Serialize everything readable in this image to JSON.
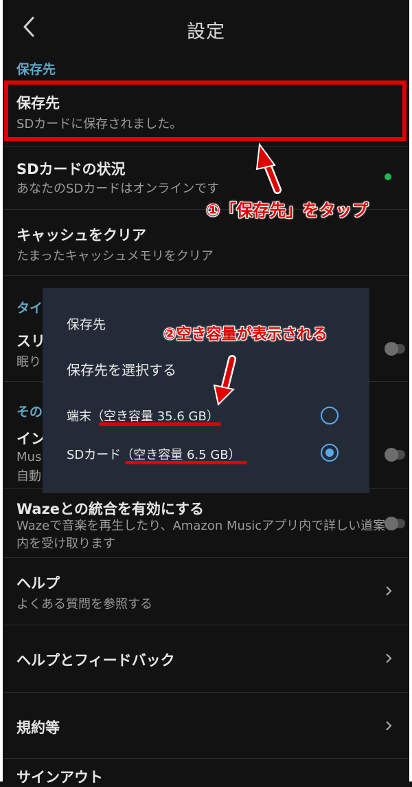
{
  "header": {
    "title": "設定",
    "back_icon": "chevron-left-icon"
  },
  "sections": {
    "storage_label": "保存先",
    "timer_label": "タイ",
    "other_label": "その"
  },
  "rows": {
    "storage": {
      "title": "保存先",
      "subtitle": "SDカードに保存されました。"
    },
    "sd_status": {
      "title": "SDカードの状況",
      "subtitle": "あなたのSDカードはオンラインです"
    },
    "clear_cache": {
      "title": "キャッシュをクリア",
      "subtitle": "たまったキャッシュメモリをクリア"
    },
    "sleep": {
      "title": "スリ",
      "subtitle": "眠り"
    },
    "install": {
      "title": "イン",
      "subtitle1": "Mus",
      "subtitle2": "自動"
    },
    "waze": {
      "title": "Wazeとの統合を有効にする",
      "subtitle": "Wazeで音楽を再生したり、Amazon Musicアプリ内で詳しい道案内を受け取ります"
    },
    "help": {
      "title": "ヘルプ",
      "subtitle": "よくある質問を参照する"
    },
    "help_feedback": {
      "title": "ヘルプとフィードバック"
    },
    "terms": {
      "title": "規約等"
    },
    "sign_out": {
      "title": "サインアウト"
    }
  },
  "dialog": {
    "title": "保存先",
    "subtitle": "保存先を選択する",
    "options": [
      {
        "label": "端末（空き容量 35.6 GB）",
        "selected": false
      },
      {
        "label": "SDカード（空き容量 6.5 GB）",
        "selected": true
      }
    ]
  },
  "annotations": {
    "step1": "①「保存先」をタップ",
    "step2": "②空き容量が表示される"
  },
  "colors": {
    "accent": "#5aa9e6",
    "annotation_red": "#e00000",
    "online_green": "#1db954",
    "background": "#121212",
    "dialog_bg": "#232b38"
  }
}
